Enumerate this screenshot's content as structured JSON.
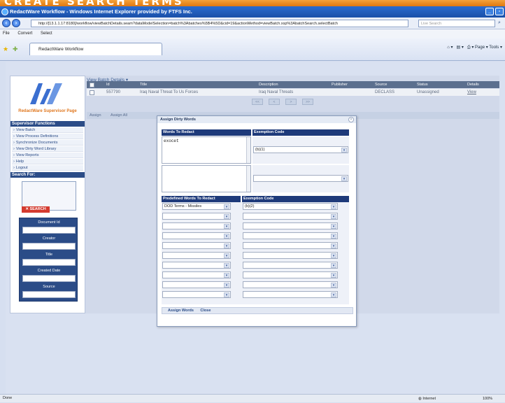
{
  "banner": {
    "text": "CREATE SEARCH TERMS"
  },
  "window": {
    "title": "RedactWare Workflow - Windows Internet Explorer provided by FTFS Inc."
  },
  "address": {
    "url": "http://[13.1.1.17:8180]/workflow/viewBatchDetails.seam?dataModelSelection=batch%3Abatches%5B4%5D&cid=19&actionMethod=viewBatch.xsp%3AbatchSearch.selectBatch",
    "search_placeholder": "Live Search"
  },
  "menubar": {
    "items": [
      "File",
      "Convert",
      "Select"
    ]
  },
  "tab": {
    "label": "RedactWare Workflow"
  },
  "commandbar": {
    "page": "Page",
    "tools": "Tools"
  },
  "left": {
    "logo_sub": "RedactWare Supervisor Page",
    "functions_head": "Supervisor Functions",
    "menu": [
      "View Batch",
      "View Process Definitions",
      "Synchronize Documents",
      "View Dirty Word Library",
      "View Reports",
      "Help",
      "Logout"
    ],
    "search_head": "Search For:",
    "search_button": "SEARCH",
    "filters": [
      "Document Id",
      "Creator",
      "Title",
      "Created Date",
      "Source"
    ]
  },
  "main": {
    "breadcrumb": "View Batch Details ▾",
    "columns": [
      "Id",
      "Title",
      "Description",
      "Publisher",
      "Source",
      "Status",
      "Details"
    ],
    "row": {
      "id": "557790",
      "title": "Iraq Naval Threat To Us Forces",
      "description": "Iraq Naval Threats",
      "publisher": "",
      "source": "DECLASS",
      "status": "Unassigned",
      "details": "View"
    },
    "pager": [
      "<<",
      "<",
      ">",
      ">>"
    ],
    "actions": [
      "Assign",
      "Assign All"
    ]
  },
  "dialog": {
    "title": "Assign Dirty Words",
    "col_words": "Words To Redact",
    "col_exemption": "Exemption Code",
    "words_value": "exocet",
    "exemption_value": "(b)(1)",
    "col_predefined": "Predefined Words To Redact",
    "col_exemption2": "Exemption Code",
    "predefined_first": "DOD Terms - Missiles",
    "exemption2_first": "(b)(2)",
    "footer_assign": "Assign Words",
    "footer_close": "Close"
  },
  "status": {
    "left": "Done",
    "zone": "Internet",
    "zoom": "100%"
  }
}
